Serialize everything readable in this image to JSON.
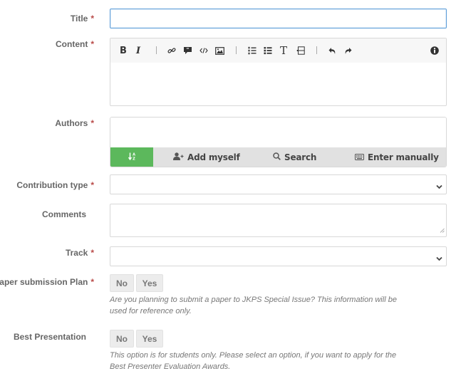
{
  "form": {
    "title": {
      "label": "Title",
      "required": "*",
      "value": ""
    },
    "content": {
      "label": "Content",
      "required": "*",
      "value": "",
      "toolbar": [
        "bold-icon",
        "italic-icon",
        "link-icon",
        "quote-icon",
        "code-icon",
        "image-icon",
        "ordered-list-icon",
        "unordered-list-icon",
        "heading-icon",
        "table-icon",
        "undo-icon",
        "redo-icon",
        "info-icon"
      ],
      "bold_label": "B",
      "italic_label": "I",
      "heading_label": "T"
    },
    "authors": {
      "label": "Authors",
      "required": "*",
      "buttons": {
        "add_myself": "Add myself",
        "search": "Search",
        "enter_manually": "Enter manually"
      },
      "sort_color": "#5cb85c"
    },
    "contribution_type": {
      "label": "Contribution type",
      "required": "*",
      "selected": ""
    },
    "comments": {
      "label": "Comments",
      "value": ""
    },
    "track": {
      "label": "Track",
      "required": "*",
      "selected": ""
    },
    "paper_submission_plan": {
      "label": "Paper submission Plan",
      "required": "*",
      "options": [
        "No",
        "Yes"
      ],
      "help_line1": "Are you planning to submit a paper to JKPS Special Issue? This information will be",
      "help_line2": "used for reference only."
    },
    "best_presentation": {
      "label": "Best Presentation",
      "options": [
        "No",
        "Yes"
      ],
      "help_line1": "This option is for students only. Please select an option, if you want to apply for the",
      "help_line2": "Best Presenter Evaluation Awards."
    }
  },
  "colors": {
    "required": "#b94a48",
    "focus": "#5b9dd9",
    "success": "#5cb85c"
  }
}
